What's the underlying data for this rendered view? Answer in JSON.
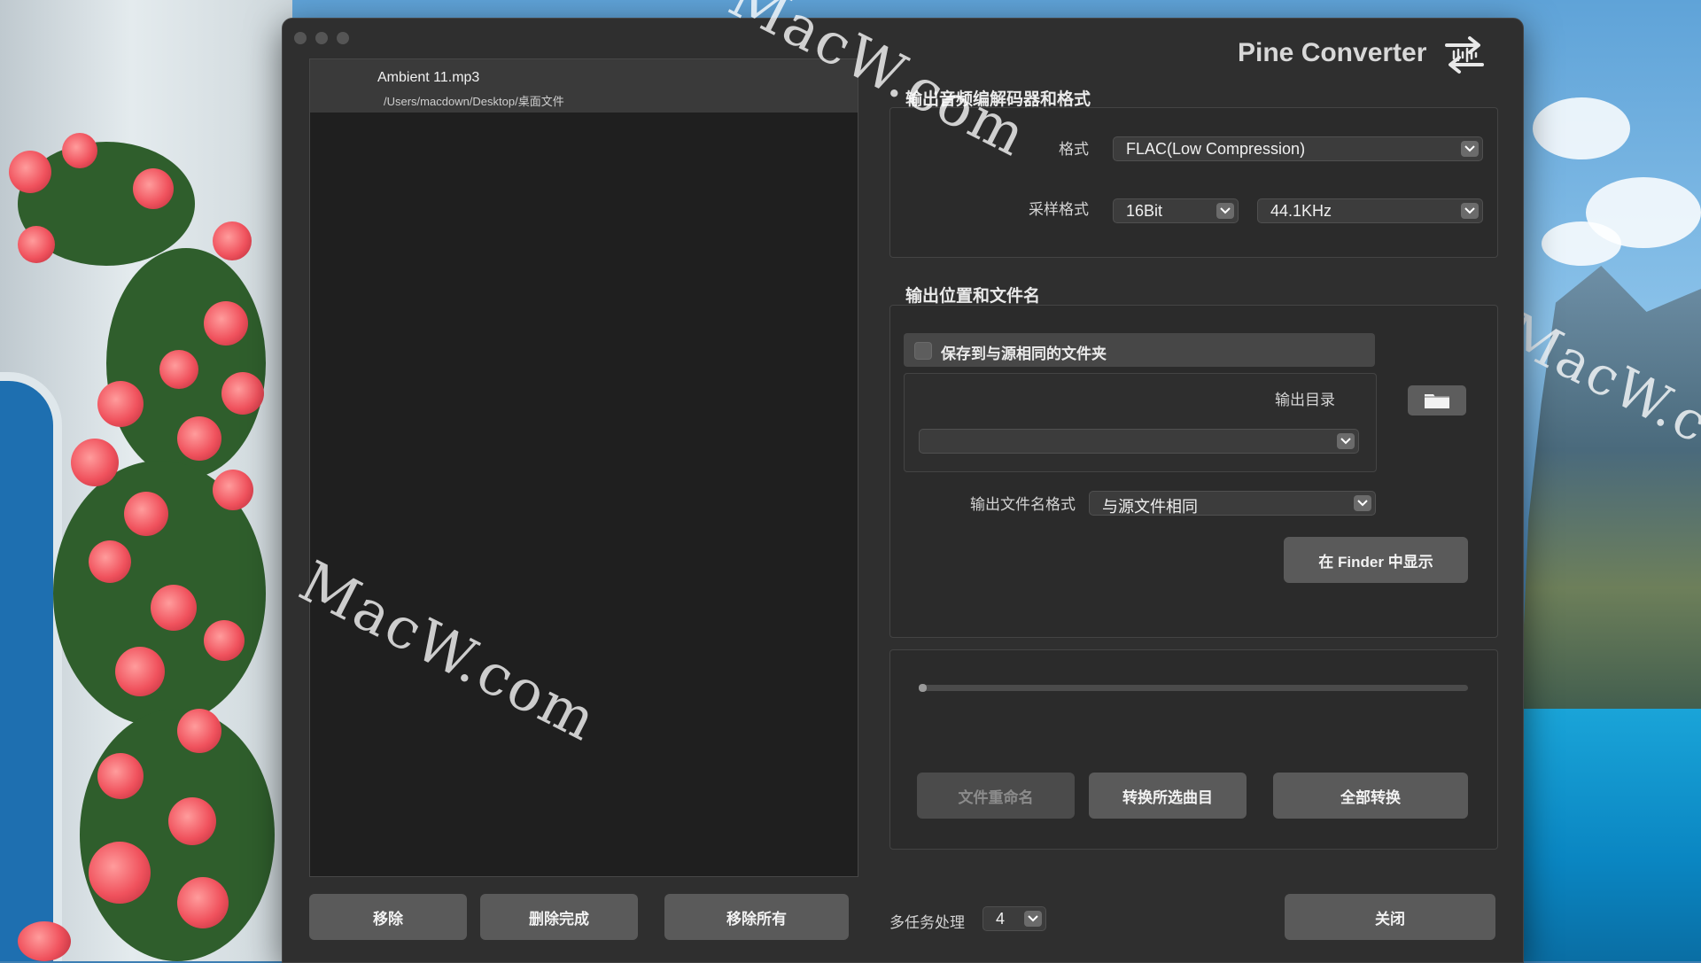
{
  "watermarks": [
    "MacW.com",
    "MacW.com",
    "MacW.c"
  ],
  "file_list": {
    "items": [
      {
        "name": "Ambient 11.mp3",
        "path": "/Users/macdown/Desktop/桌面文件"
      }
    ]
  },
  "bottom_left_buttons": {
    "remove": "移除",
    "remove_finished": "删除完成",
    "remove_all": "移除所有"
  },
  "header": {
    "title": "Pine Converter",
    "logo_icon": "convert-arrows-icon"
  },
  "codec_section": {
    "title": "输出音频编解码器和格式",
    "format_label": "格式",
    "format_value": "FLAC(Low Compression)",
    "sample_label": "采样格式",
    "bit_depth_value": "16Bit",
    "sample_rate_value": "44.1KHz"
  },
  "output_section": {
    "title": "输出位置和文件名",
    "same_folder_label": "保存到与源相同的文件夹",
    "same_folder_checked": false,
    "output_dir_label": "输出目录",
    "output_dir_value": "",
    "filename_format_label": "输出文件名格式",
    "filename_format_value": "与源文件相同",
    "show_in_finder": "在 Finder 中显示"
  },
  "convert_section": {
    "progress": 0,
    "rename_button": "文件重命名",
    "rename_enabled": false,
    "convert_selected_button": "转换所选曲目",
    "convert_all_button": "全部转换"
  },
  "footer": {
    "multitask_label": "多任务处理",
    "multitask_value": "4",
    "close_button": "关闭"
  },
  "colors": {
    "window_bg": "#2f2f2f",
    "list_bg": "#1f1f1f",
    "button_bg": "#5a5a5a",
    "text": "#f2f2f2"
  }
}
